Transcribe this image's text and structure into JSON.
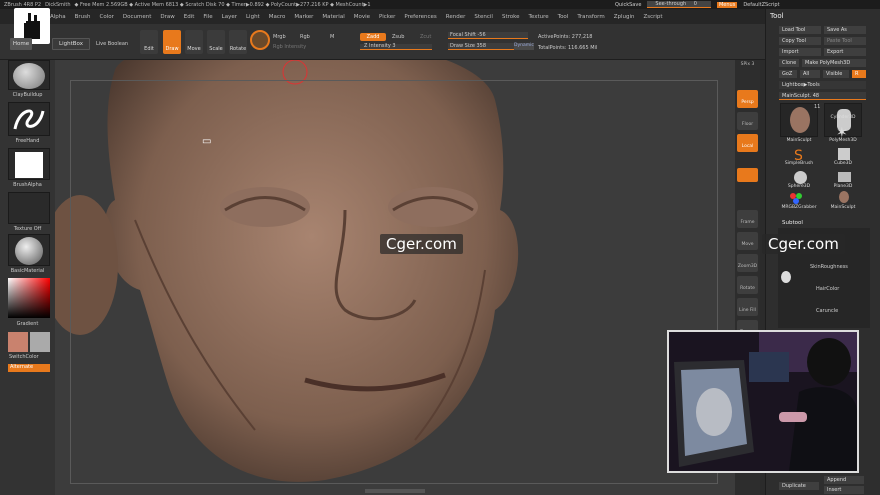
{
  "titlebar": {
    "app": "ZBrush 4R8 P2",
    "user": "DickSmith",
    "stats": "◆ Free Mem 2.569GB ◆ Active Mem 6813 ◆ Scratch Disk 70 ◆ Timer▶0.892 ◆ PolyCount▶277.216 KP ◆ MeshCount▶1",
    "quicksave": "QuickSave",
    "seethrough": "See-through",
    "seethrough_value": "0",
    "menus": "Menus",
    "script": "DefaultZScript"
  },
  "menubar": [
    "Alpha",
    "Brush",
    "Color",
    "Document",
    "Draw",
    "Edit",
    "File",
    "Layer",
    "Light",
    "Macro",
    "Marker",
    "Material",
    "Movie",
    "Picker",
    "Preferences",
    "Render",
    "Stencil",
    "Stroke",
    "Texture",
    "Tool",
    "Transform",
    "Zplugin",
    "Zscript"
  ],
  "toolbar": {
    "home": "Home",
    "lightbox": "LightBox",
    "live_boolean": "Live Boolean",
    "edit": "Edit",
    "draw": "Draw",
    "move": "Move",
    "scale": "Scale",
    "rotate": "Rotate",
    "mrgb": "Mrgb",
    "rgb": "Rgb",
    "m": "M",
    "zadd": "Zadd",
    "zsub": "Zsub",
    "zcut": "Zcut",
    "rgb_intensity": "Rgb Intensity",
    "z_intensity": "Z Intensity 3",
    "focal_shift": "Focal Shift -56",
    "draw_size": "Draw Size 358",
    "dynamic": "Dynamic",
    "active_points": "ActivePoints: 277,218",
    "total_points": "TotalPoints: 116.665 Mil"
  },
  "leftbar": {
    "brush": "ClayBuildup",
    "stroke": "FreeHand",
    "alpha": "BrushAlpha",
    "texture": "Texture Off",
    "material": "BasicMaterial",
    "gradient": "Gradient",
    "switch_color": "SwitchColor",
    "alternate": "Alternate"
  },
  "colors": {
    "accent": "#e8791c",
    "main_color": "#c9826e",
    "secondary_color": "#aaaaaa"
  },
  "rightshelf": [
    "SPix 3",
    "Persp",
    "Floor",
    "Local",
    "Frame",
    "Move",
    "Zoom3D",
    "Rotate",
    "Line Fill",
    "Transp",
    "Solo"
  ],
  "toolpanel": {
    "title": "Tool",
    "buttons": [
      "Load Tool",
      "Save As",
      "Copy Tool",
      "Paste Tool",
      "Import",
      "Export",
      "Clone",
      "Make PolyMesh3D",
      "GoZ",
      "All",
      "Visible",
      "R"
    ],
    "lightbox_tools": "Lightbox▶Tools",
    "main_sculpt": "MainSculpt. 48",
    "thumbs": [
      "MainSculpt",
      "Cylinder3D",
      "PolyMesh3D",
      "SimpleBrush",
      "Cube3D",
      "Sphere3D",
      "Plane3D",
      "MRGBZGrabber",
      "MainSculpt"
    ],
    "count": "11",
    "subtool": "Subtool",
    "subtools": [
      "SkinRoughness",
      "HairColor",
      "Caruncle"
    ],
    "bottom": [
      "Duplicate",
      "Append",
      "Insert"
    ]
  },
  "watermark": "Cger.com"
}
